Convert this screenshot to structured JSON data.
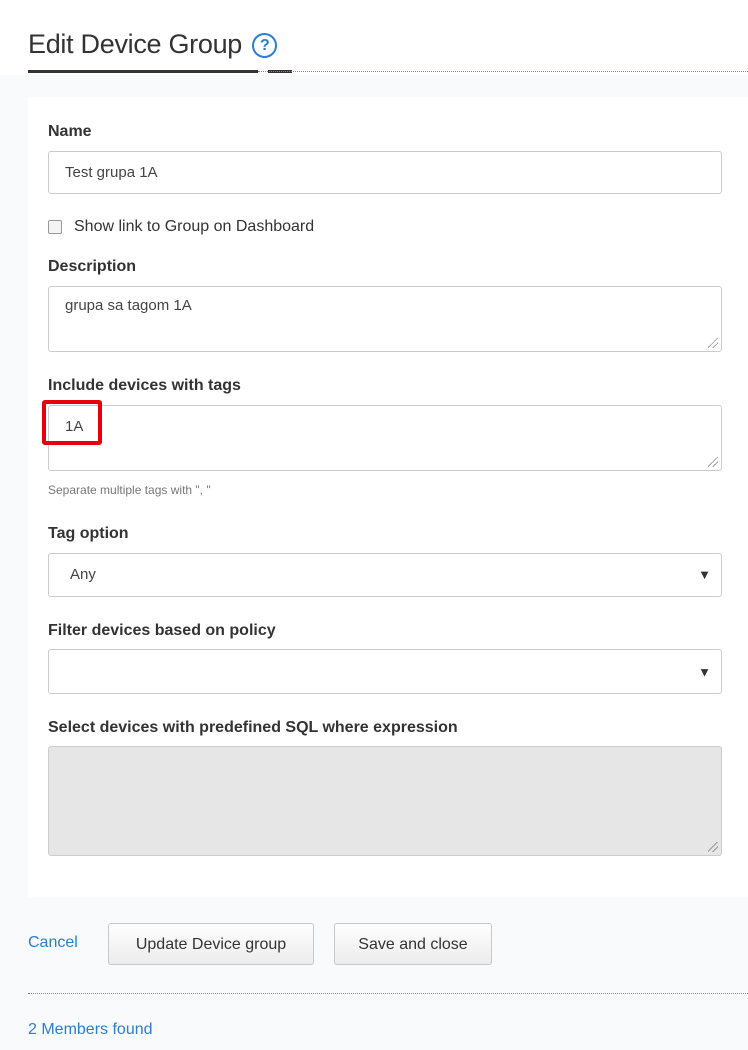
{
  "header": {
    "title": "Edit Device Group",
    "help_icon": "?"
  },
  "form": {
    "name_label": "Name",
    "name_value": "Test grupa 1A",
    "show_link_label": "Show link to Group on Dashboard",
    "show_link_checked": false,
    "description_label": "Description",
    "description_value": "grupa sa tagom 1A",
    "tags_label": "Include devices with tags",
    "tags_value": "1A",
    "tags_hint": "Separate multiple tags with \", \"",
    "tag_option_label": "Tag option",
    "tag_option_value": "Any",
    "policy_label": "Filter devices based on policy",
    "policy_value": "",
    "sql_label": "Select devices with predefined SQL where expression",
    "sql_value": ""
  },
  "actions": {
    "cancel_label": "Cancel",
    "update_label": "Update Device group",
    "save_close_label": "Save and close"
  },
  "footer": {
    "members_found": "2 Members found"
  },
  "colors": {
    "link": "#2a7fd4",
    "highlight": "#e8000b"
  }
}
